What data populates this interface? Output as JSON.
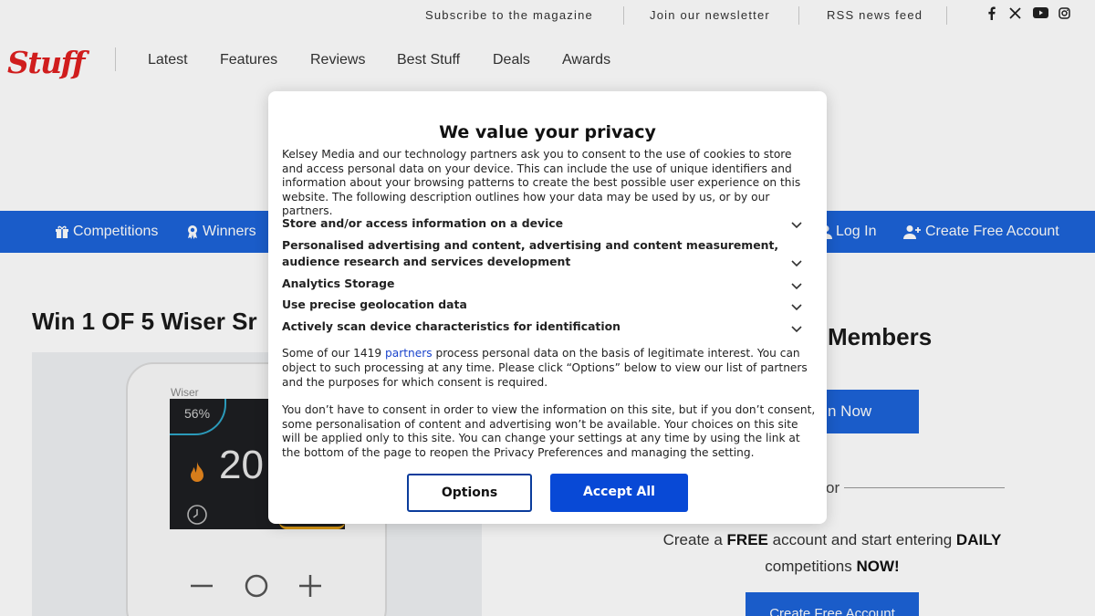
{
  "topbar": {
    "links": [
      "Subscribe to the magazine",
      "Join our newsletter",
      "RSS news feed"
    ],
    "social_icons": [
      "facebook-icon",
      "x-icon",
      "youtube-icon",
      "instagram-icon"
    ]
  },
  "header": {
    "logo": "Stuff",
    "nav": [
      "Latest",
      "Features",
      "Reviews",
      "Best Stuff",
      "Deals",
      "Awards"
    ]
  },
  "bluebar": {
    "left": [
      "Competitions",
      "Winners"
    ],
    "right": [
      "Log In",
      "Create Free Account"
    ],
    "color": "#1c64d9"
  },
  "article": {
    "headline": "Win 1 OF 5 Wiser Sr",
    "thermostat": {
      "brand": "Wiser",
      "humidity": "56%",
      "temperature": "20"
    }
  },
  "sidebar": {
    "members_title": "Members",
    "join_button": "n Now",
    "or": "or",
    "free_text": {
      "p1": "Create a ",
      "b1": "FREE",
      "p2": " account and start entering ",
      "b2": "DAILY",
      "p3": " competitions ",
      "b3": "NOW!"
    },
    "create_button": "Create Free Account"
  },
  "privacy_modal": {
    "title": "We value your privacy",
    "intro": "Kelsey Media and our technology partners ask you to consent to the use of cookies to store and access personal data on your device. This can include the use of unique identifiers and information about your browsing patterns to create the best possible user experience on this website. The following description outlines how your data may be used by us, or by our partners.",
    "purposes": [
      "Store and/or access information on a device",
      "Personalised advertising and content, advertising and content measurement, audience research and services development",
      "Analytics Storage",
      "Use precise geolocation data",
      "Actively scan device characteristics for identification"
    ],
    "partners_text": {
      "before": "Some of our 1419 ",
      "link": "partners",
      "after": " process personal data on the basis of legitimate interest. You can object to such processing at any time. Please click “Options” below to view our list of partners and the purposes for which consent is required."
    },
    "consent_note": "You don’t have to consent in order to view the information on this site, but if you don’t consent, some personalisation of content and advertising won’t be available. Your choices on this site will be applied only to this site. You can change your settings at any time by using the link at the bottom of the page to reopen the Privacy Preferences and managing the setting.",
    "options_button": "Options",
    "accept_button": "Accept All",
    "accent_color": "#0849d6"
  }
}
